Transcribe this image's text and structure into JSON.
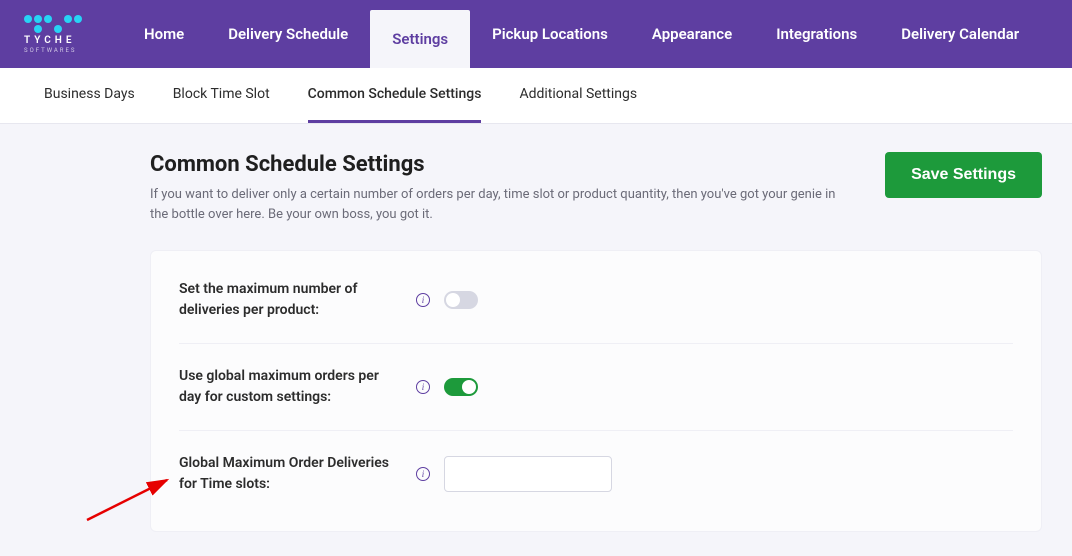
{
  "logo": {
    "text": "TYCHE",
    "sub": "SOFTWARES"
  },
  "nav": {
    "items": [
      {
        "label": "Home"
      },
      {
        "label": "Delivery Schedule"
      },
      {
        "label": "Settings",
        "active": true
      },
      {
        "label": "Pickup Locations"
      },
      {
        "label": "Appearance"
      },
      {
        "label": "Integrations"
      },
      {
        "label": "Delivery Calendar"
      }
    ]
  },
  "subnav": {
    "items": [
      {
        "label": "Business Days"
      },
      {
        "label": "Block Time Slot"
      },
      {
        "label": "Common Schedule Settings",
        "active": true
      },
      {
        "label": "Additional Settings"
      }
    ]
  },
  "page": {
    "title": "Common Schedule Settings",
    "desc": "If you want to deliver only a certain number of orders per day, time slot or product quantity, then you've got your genie in the bottle over here. Be your own boss, you got it.",
    "save_label": "Save Settings"
  },
  "settings": {
    "max_per_product": {
      "label": "Set the maximum number of deliveries per product:",
      "value": false
    },
    "use_global_max": {
      "label": "Use global maximum orders per day for custom settings:",
      "value": true
    },
    "global_max_timeslot": {
      "label": "Global Maximum Order Deliveries for Time slots:",
      "value": ""
    }
  }
}
